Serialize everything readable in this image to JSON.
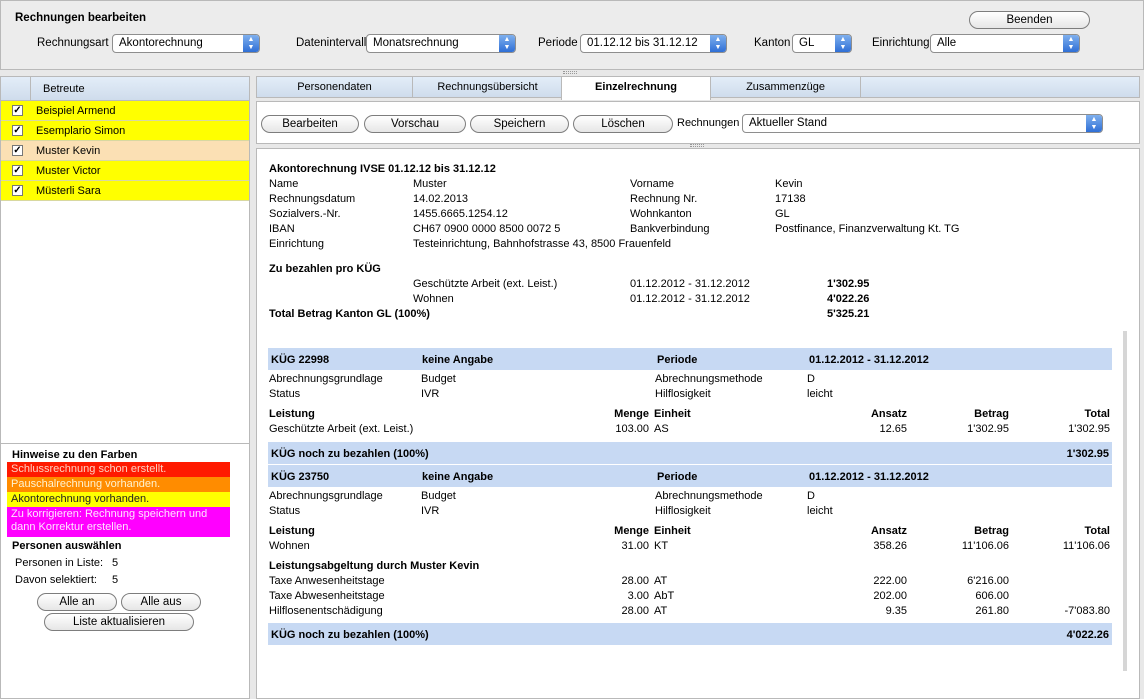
{
  "header": {
    "title": "Rechnungen bearbeiten",
    "end_button": "Beenden",
    "filters": {
      "rechnungsart_label": "Rechnungsart",
      "rechnungsart_value": "Akontorechnung",
      "datenintervall_label": "Datenintervall",
      "datenintervall_value": "Monatsrechnung",
      "periode_label": "Periode",
      "periode_value": "01.12.12 bis 31.12.12",
      "kanton_label": "Kanton",
      "kanton_value": "GL",
      "einrichtung_label": "Einrichtung",
      "einrichtung_value": "Alle"
    }
  },
  "sidebar": {
    "column_header": "Betreute",
    "persons": [
      {
        "name": "Beispiel Armend",
        "checked": true,
        "color": "#ffff00"
      },
      {
        "name": "Esemplario Simon",
        "checked": true,
        "color": "#ffff00"
      },
      {
        "name": "Muster Kevin",
        "checked": true,
        "color": "#fbe0b4"
      },
      {
        "name": "Muster Victor",
        "checked": true,
        "color": "#ffff00"
      },
      {
        "name": "Müsterli Sara",
        "checked": true,
        "color": "#ffff00"
      }
    ],
    "legend_title": "Hinweise zu den Farben",
    "legend": [
      {
        "text": "Schlussrechnung schon erstellt.",
        "color": "#ff1a00"
      },
      {
        "text": "Pauschalrechnung vorhanden.",
        "color": "#ff8c00"
      },
      {
        "text": "Akontorechnung vorhanden.",
        "color": "#ffff00"
      },
      {
        "text": "Zu korrigieren: Rechnung speichern und dann Korrektur erstellen.",
        "color": "#ff00ff"
      }
    ],
    "select_title": "Personen auswählen",
    "persons_in_list_label": "Personen in Liste:",
    "persons_in_list_value": "5",
    "selected_label": "Davon selektiert:",
    "selected_value": "5",
    "all_on": "Alle an",
    "all_off": "Alle aus",
    "refresh": "Liste aktualisieren"
  },
  "tabs": [
    "Personendaten",
    "Rechnungsübersicht",
    "Einzelrechnung",
    "Zusammenzüge"
  ],
  "toolbar": {
    "edit": "Bearbeiten",
    "preview": "Vorschau",
    "save": "Speichern",
    "delete": "Löschen",
    "invoices_label": "Rechnungen",
    "invoices_value": "Aktueller Stand"
  },
  "invoice": {
    "title": "Akontorechnung IVSE 01.12.12 bis 31.12.12",
    "name_label": "Name",
    "name_value": "Muster",
    "vorname_label": "Vorname",
    "vorname_value": "Kevin",
    "datum_label": "Rechnungsdatum",
    "datum_value": "14.02.2013",
    "nr_label": "Rechnung Nr.",
    "nr_value": "17138",
    "sv_label": "Sozialvers.-Nr.",
    "sv_value": "1455.6665.1254.12",
    "wk_label": "Wohnkanton",
    "wk_value": "GL",
    "iban_label": "IBAN",
    "iban_value": "CH67 0900 0000 8500 0072 5",
    "bank_label": "Bankverbindung",
    "bank_value": "Postfinance, Finanzverwaltung Kt. TG",
    "einr_label": "Einrichtung",
    "einr_value": "Testeinrichtung, Bahnhofstrasse 43, 8500 Frauenfeld",
    "pay_title": "Zu bezahlen pro KÜG",
    "pay_rows": [
      {
        "label": "Geschützte Arbeit (ext. Leist.)",
        "period": "01.12.2012 - 31.12.2012",
        "amount": "1'302.95"
      },
      {
        "label": "Wohnen",
        "period": "01.12.2012 - 31.12.2012",
        "amount": "4'022.26"
      }
    ],
    "total_label": "Total Betrag Kanton GL (100%)",
    "total_value": "5'325.21"
  },
  "kug1": {
    "id": "KÜG 22998",
    "info": "keine Angabe",
    "periode_label": "Periode",
    "periode": "01.12.2012 - 31.12.2012",
    "agl_label": "Abrechnungsgrundlage",
    "agl_value": "Budget",
    "am_label": "Abrechnungsmethode",
    "am_value": "D",
    "status_label": "Status",
    "status_value": "IVR",
    "hl_label": "Hilflosigkeit",
    "hl_value": "leicht",
    "col_leistung": "Leistung",
    "col_menge": "Menge",
    "col_einheit": "Einheit",
    "col_ansatz": "Ansatz",
    "col_betrag": "Betrag",
    "col_total": "Total",
    "row": {
      "leistung": "Geschützte Arbeit (ext. Leist.)",
      "menge": "103.00",
      "einheit": "AS",
      "ansatz": "12.65",
      "betrag": "1'302.95",
      "total": "1'302.95"
    },
    "due_label": "KÜG noch zu bezahlen (100%)",
    "due_value": "1'302.95"
  },
  "kug2": {
    "id": "KÜG 23750",
    "info": "keine Angabe",
    "periode_label": "Periode",
    "periode": "01.12.2012 - 31.12.2012",
    "agl_label": "Abrechnungsgrundlage",
    "agl_value": "Budget",
    "am_label": "Abrechnungsmethode",
    "am_value": "D",
    "status_label": "Status",
    "status_value": "IVR",
    "hl_label": "Hilflosigkeit",
    "hl_value": "leicht",
    "col_leistung": "Leistung",
    "col_menge": "Menge",
    "col_einheit": "Einheit",
    "col_ansatz": "Ansatz",
    "col_betrag": "Betrag",
    "col_total": "Total",
    "row": {
      "leistung": "Wohnen",
      "menge": "31.00",
      "einheit": "KT",
      "ansatz": "358.26",
      "betrag": "11'106.06",
      "total": "11'106.06"
    },
    "abg_title": "Leistungsabgeltung durch Muster Kevin",
    "abg_rows": [
      {
        "leistung": "Taxe Anwesenheitstage",
        "menge": "28.00",
        "einheit": "AT",
        "ansatz": "222.00",
        "betrag": "6'216.00",
        "total": ""
      },
      {
        "leistung": "Taxe Abwesenheitstage",
        "menge": "3.00",
        "einheit": "AbT",
        "ansatz": "202.00",
        "betrag": "606.00",
        "total": ""
      },
      {
        "leistung": "Hilflosenentschädigung",
        "menge": "28.00",
        "einheit": "AT",
        "ansatz": "9.35",
        "betrag": "261.80",
        "total": "-7'083.80"
      }
    ],
    "due_label": "KÜG noch zu bezahlen (100%)",
    "due_value": "4'022.26"
  }
}
